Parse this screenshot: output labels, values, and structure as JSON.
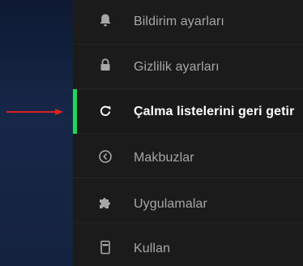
{
  "colors": {
    "accent": "#1ed760",
    "arrow": "#e0201e",
    "text_muted": "#a7a7a7",
    "text_active": "#ffffff",
    "menu_bg": "#1b1b1b",
    "left_bg": "#172748"
  },
  "menu": {
    "items": [
      {
        "label": "Bildirim ayarları",
        "icon": "bell-icon"
      },
      {
        "label": "Gizlilik ayarları",
        "icon": "lock-icon"
      },
      {
        "label": "Çalma listelerini geri getir",
        "icon": "refresh-icon",
        "active": true
      },
      {
        "label": "Makbuzlar",
        "icon": "clock-back-icon"
      },
      {
        "label": "Uygulamalar",
        "icon": "puzzle-icon"
      },
      {
        "label": "Kullan",
        "icon": "device-icon"
      }
    ]
  }
}
